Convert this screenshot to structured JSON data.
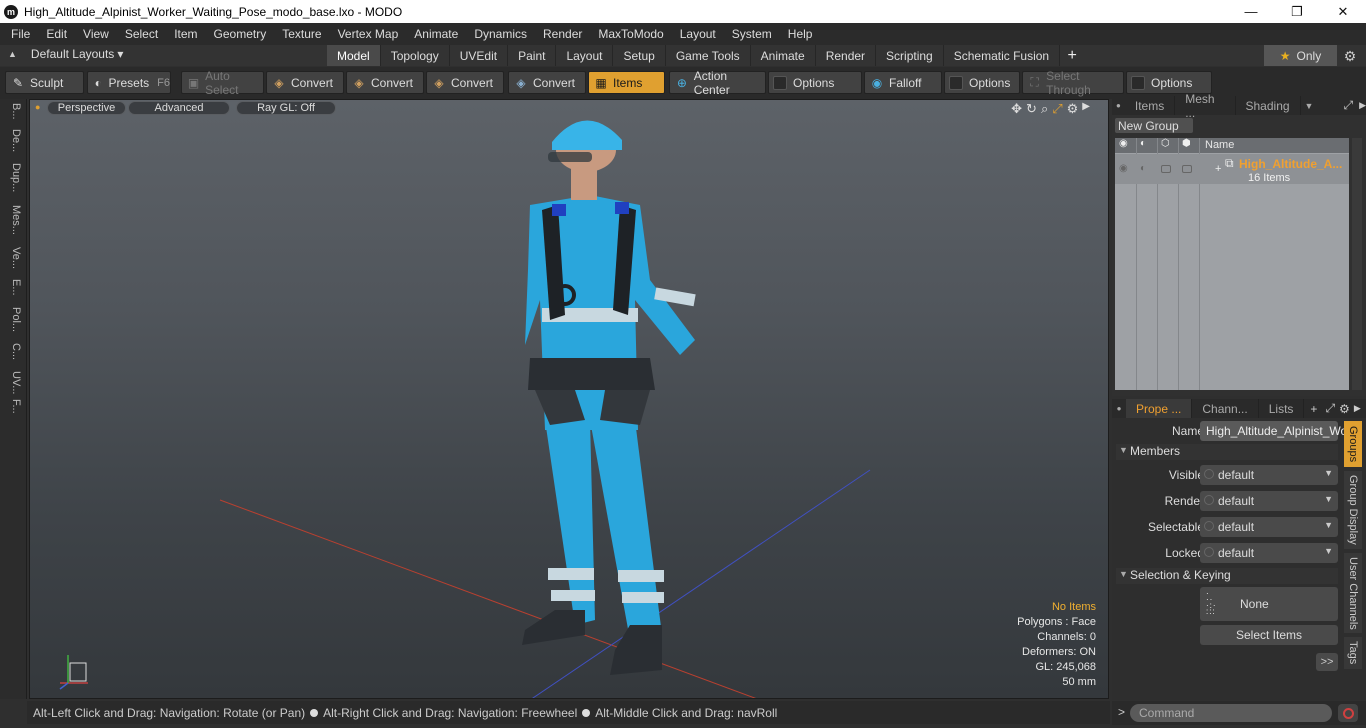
{
  "window": {
    "title": "High_Altitude_Alpinist_Worker_Waiting_Pose_modo_base.lxo - MODO",
    "app_icon": "modo-logo-icon",
    "minimize": "—",
    "restore": "❐",
    "close": "✕"
  },
  "menu": [
    "File",
    "Edit",
    "View",
    "Select",
    "Item",
    "Geometry",
    "Texture",
    "Vertex Map",
    "Animate",
    "Dynamics",
    "Render",
    "MaxToModo",
    "Layout",
    "System",
    "Help"
  ],
  "layouts": {
    "label": "Default Layouts",
    "arrow": "▾"
  },
  "tabs": [
    "Model",
    "Topology",
    "UVEdit",
    "Paint",
    "Layout",
    "Setup",
    "Game Tools",
    "Animate",
    "Render",
    "Scripting",
    "Schematic Fusion"
  ],
  "active_tab": "Model",
  "tab_plus": "+",
  "only_label": "Only",
  "toolbar": {
    "sculpt": "Sculpt",
    "presets": "Presets",
    "presets_key": "F6",
    "auto_select": "Auto Select",
    "convert1": "Convert",
    "convert2": "Convert",
    "convert3": "Convert",
    "convert4": "Convert",
    "items": "Items",
    "action_center": "Action Center",
    "options1": "Options",
    "falloff": "Falloff",
    "options2": "Options",
    "select_through": "Select Through",
    "options3": "Options"
  },
  "left_strip": [
    "B...",
    "De...",
    "Dup...",
    "Mes...",
    "Ve...",
    "E...",
    "Pol...",
    "C...",
    "UV...",
    "F..."
  ],
  "viewport": {
    "perspective": "Perspective",
    "advanced": "Advanced",
    "raygl": "Ray GL: Off",
    "info": {
      "no_items": "No Items",
      "polygons": "Polygons : Face",
      "channels": "Channels: 0",
      "deformers": "Deformers: ON",
      "gl": "GL: 245,068",
      "scale": "50 mm"
    }
  },
  "status": {
    "part1": "Alt-Left Click and Drag: Navigation: Rotate (or Pan)",
    "part2": "Alt-Right Click and Drag: Navigation: Freewheel",
    "part3": "Alt-Middle Click and Drag: navRoll"
  },
  "groups_panel": {
    "tabs": [
      "Items",
      "Mesh ...",
      "Shading"
    ],
    "new_group": "New Group",
    "col_name": "Name",
    "group_name": "High_Altitude_A...",
    "group_count": "16 Items"
  },
  "props_panel": {
    "tabs": [
      "Prope ...",
      "Chann...",
      "Lists"
    ],
    "plus": "+",
    "name_label": "Name",
    "name_value": "High_Altitude_Alpinist_Wo",
    "members": "Members",
    "visible_label": "Visible",
    "visible_value": "default",
    "render_label": "Render",
    "render_value": "default",
    "selectable_label": "Selectable",
    "selectable_value": "default",
    "locked_label": "Locked",
    "locked_value": "default",
    "sel_keying": "Selection & Keying",
    "none": "None",
    "select_items": "Select Items",
    "more": ">>",
    "side_tabs": [
      "Groups",
      "Group Display",
      "User Channels",
      "Tags"
    ]
  },
  "command": {
    "placeholder": "Command",
    "prompt": ">"
  },
  "colors": {
    "accent": "#e0a030",
    "suit": "#2aa6dc"
  }
}
